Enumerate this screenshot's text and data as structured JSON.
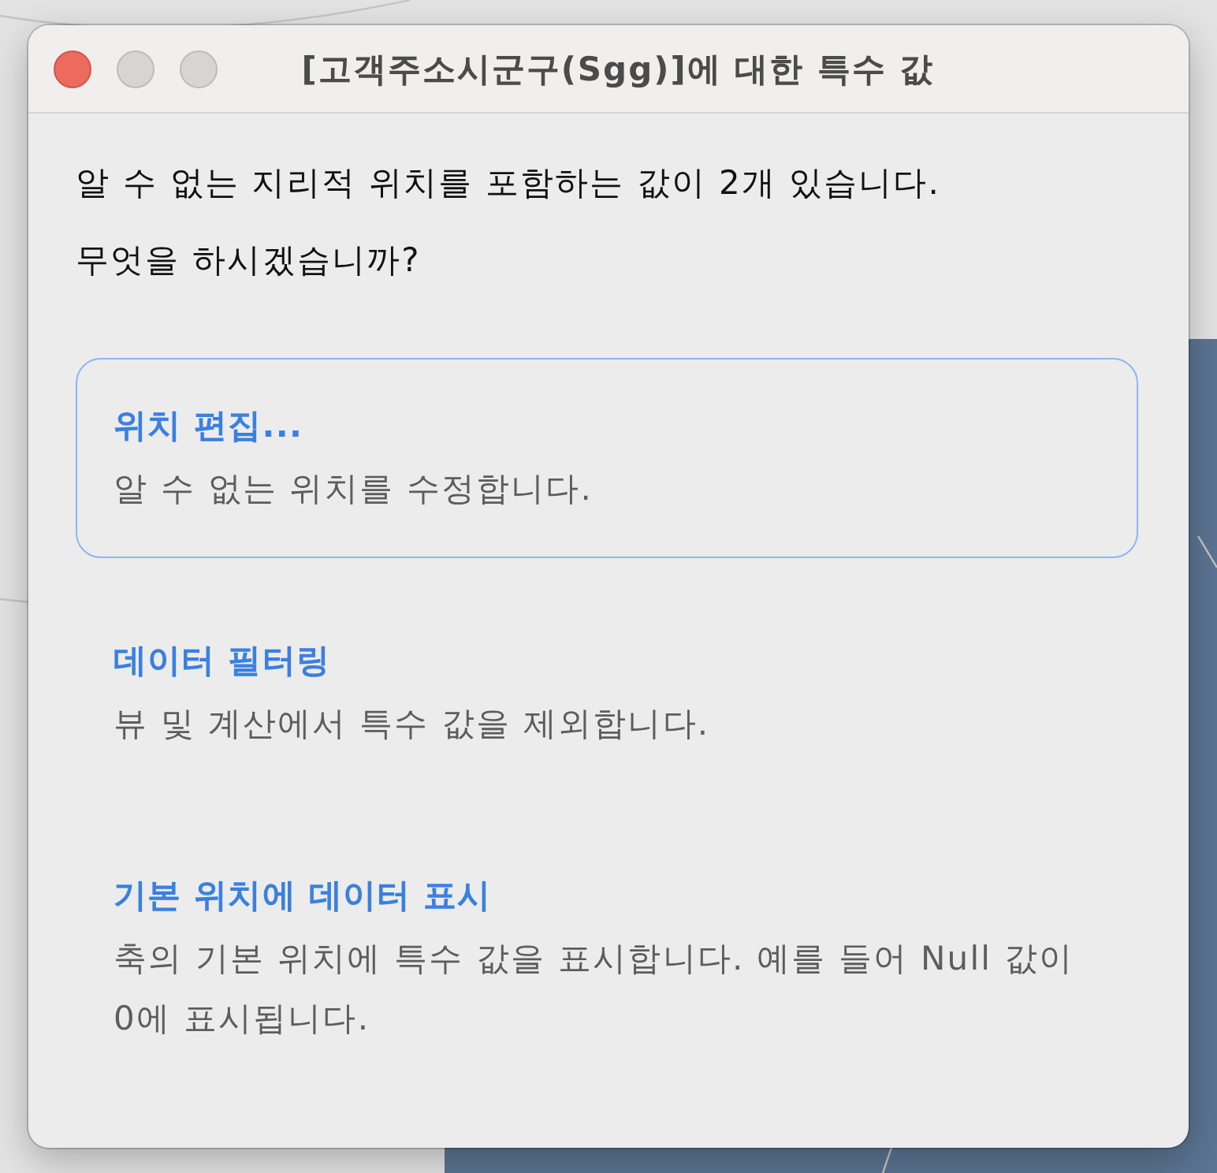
{
  "window": {
    "title": "[고객주소시군구(Sgg)]에 대한 특수 값",
    "controls": [
      {
        "kind": "close",
        "disabled": false
      },
      {
        "kind": "minimize",
        "disabled": true
      },
      {
        "kind": "zoom",
        "disabled": true
      }
    ]
  },
  "message": "알 수 없는 지리적 위치를 포함하는 값이 2개 있습니다.",
  "question": "무엇을 하시겠습니까?",
  "options": [
    {
      "title": "위치 편집...",
      "description": "알 수 없는 위치를 수정합니다.",
      "selected": true
    },
    {
      "title": "데이터 필터링",
      "description": "뷰 및 계산에서 특수 값을 제외합니다.",
      "selected": false
    },
    {
      "title": "기본 위치에 데이터 표시",
      "description": "축의 기본 위치에 특수 값을 표시합니다. 예를 들어 Null 값이 0에 표시됩니다.",
      "selected": false
    }
  ]
}
